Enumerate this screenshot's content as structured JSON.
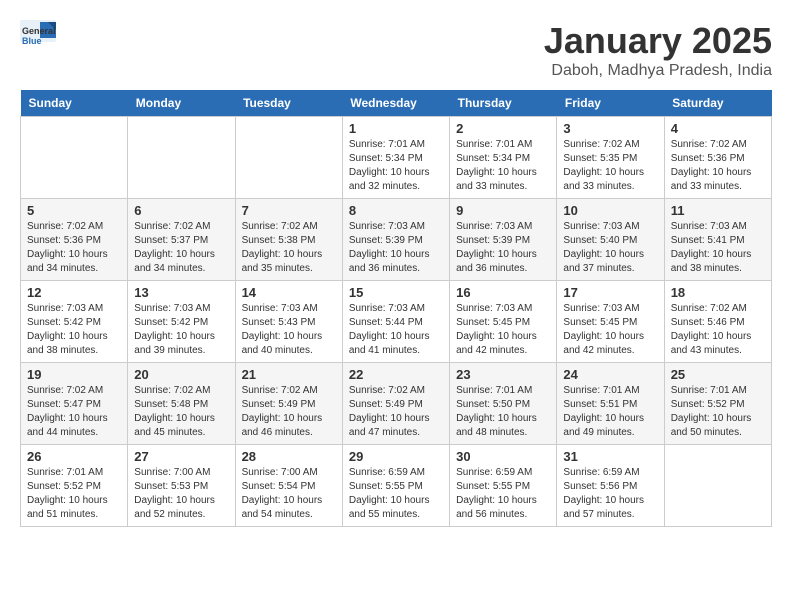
{
  "logo": {
    "general": "General",
    "blue": "Blue"
  },
  "title": "January 2025",
  "location": "Daboh, Madhya Pradesh, India",
  "headers": [
    "Sunday",
    "Monday",
    "Tuesday",
    "Wednesday",
    "Thursday",
    "Friday",
    "Saturday"
  ],
  "weeks": [
    [
      {
        "day": "",
        "info": ""
      },
      {
        "day": "",
        "info": ""
      },
      {
        "day": "",
        "info": ""
      },
      {
        "day": "1",
        "info": "Sunrise: 7:01 AM\nSunset: 5:34 PM\nDaylight: 10 hours\nand 32 minutes."
      },
      {
        "day": "2",
        "info": "Sunrise: 7:01 AM\nSunset: 5:34 PM\nDaylight: 10 hours\nand 33 minutes."
      },
      {
        "day": "3",
        "info": "Sunrise: 7:02 AM\nSunset: 5:35 PM\nDaylight: 10 hours\nand 33 minutes."
      },
      {
        "day": "4",
        "info": "Sunrise: 7:02 AM\nSunset: 5:36 PM\nDaylight: 10 hours\nand 33 minutes."
      }
    ],
    [
      {
        "day": "5",
        "info": "Sunrise: 7:02 AM\nSunset: 5:36 PM\nDaylight: 10 hours\nand 34 minutes."
      },
      {
        "day": "6",
        "info": "Sunrise: 7:02 AM\nSunset: 5:37 PM\nDaylight: 10 hours\nand 34 minutes."
      },
      {
        "day": "7",
        "info": "Sunrise: 7:02 AM\nSunset: 5:38 PM\nDaylight: 10 hours\nand 35 minutes."
      },
      {
        "day": "8",
        "info": "Sunrise: 7:03 AM\nSunset: 5:39 PM\nDaylight: 10 hours\nand 36 minutes."
      },
      {
        "day": "9",
        "info": "Sunrise: 7:03 AM\nSunset: 5:39 PM\nDaylight: 10 hours\nand 36 minutes."
      },
      {
        "day": "10",
        "info": "Sunrise: 7:03 AM\nSunset: 5:40 PM\nDaylight: 10 hours\nand 37 minutes."
      },
      {
        "day": "11",
        "info": "Sunrise: 7:03 AM\nSunset: 5:41 PM\nDaylight: 10 hours\nand 38 minutes."
      }
    ],
    [
      {
        "day": "12",
        "info": "Sunrise: 7:03 AM\nSunset: 5:42 PM\nDaylight: 10 hours\nand 38 minutes."
      },
      {
        "day": "13",
        "info": "Sunrise: 7:03 AM\nSunset: 5:42 PM\nDaylight: 10 hours\nand 39 minutes."
      },
      {
        "day": "14",
        "info": "Sunrise: 7:03 AM\nSunset: 5:43 PM\nDaylight: 10 hours\nand 40 minutes."
      },
      {
        "day": "15",
        "info": "Sunrise: 7:03 AM\nSunset: 5:44 PM\nDaylight: 10 hours\nand 41 minutes."
      },
      {
        "day": "16",
        "info": "Sunrise: 7:03 AM\nSunset: 5:45 PM\nDaylight: 10 hours\nand 42 minutes."
      },
      {
        "day": "17",
        "info": "Sunrise: 7:03 AM\nSunset: 5:45 PM\nDaylight: 10 hours\nand 42 minutes."
      },
      {
        "day": "18",
        "info": "Sunrise: 7:02 AM\nSunset: 5:46 PM\nDaylight: 10 hours\nand 43 minutes."
      }
    ],
    [
      {
        "day": "19",
        "info": "Sunrise: 7:02 AM\nSunset: 5:47 PM\nDaylight: 10 hours\nand 44 minutes."
      },
      {
        "day": "20",
        "info": "Sunrise: 7:02 AM\nSunset: 5:48 PM\nDaylight: 10 hours\nand 45 minutes."
      },
      {
        "day": "21",
        "info": "Sunrise: 7:02 AM\nSunset: 5:49 PM\nDaylight: 10 hours\nand 46 minutes."
      },
      {
        "day": "22",
        "info": "Sunrise: 7:02 AM\nSunset: 5:49 PM\nDaylight: 10 hours\nand 47 minutes."
      },
      {
        "day": "23",
        "info": "Sunrise: 7:01 AM\nSunset: 5:50 PM\nDaylight: 10 hours\nand 48 minutes."
      },
      {
        "day": "24",
        "info": "Sunrise: 7:01 AM\nSunset: 5:51 PM\nDaylight: 10 hours\nand 49 minutes."
      },
      {
        "day": "25",
        "info": "Sunrise: 7:01 AM\nSunset: 5:52 PM\nDaylight: 10 hours\nand 50 minutes."
      }
    ],
    [
      {
        "day": "26",
        "info": "Sunrise: 7:01 AM\nSunset: 5:52 PM\nDaylight: 10 hours\nand 51 minutes."
      },
      {
        "day": "27",
        "info": "Sunrise: 7:00 AM\nSunset: 5:53 PM\nDaylight: 10 hours\nand 52 minutes."
      },
      {
        "day": "28",
        "info": "Sunrise: 7:00 AM\nSunset: 5:54 PM\nDaylight: 10 hours\nand 54 minutes."
      },
      {
        "day": "29",
        "info": "Sunrise: 6:59 AM\nSunset: 5:55 PM\nDaylight: 10 hours\nand 55 minutes."
      },
      {
        "day": "30",
        "info": "Sunrise: 6:59 AM\nSunset: 5:55 PM\nDaylight: 10 hours\nand 56 minutes."
      },
      {
        "day": "31",
        "info": "Sunrise: 6:59 AM\nSunset: 5:56 PM\nDaylight: 10 hours\nand 57 minutes."
      },
      {
        "day": "",
        "info": ""
      }
    ]
  ]
}
